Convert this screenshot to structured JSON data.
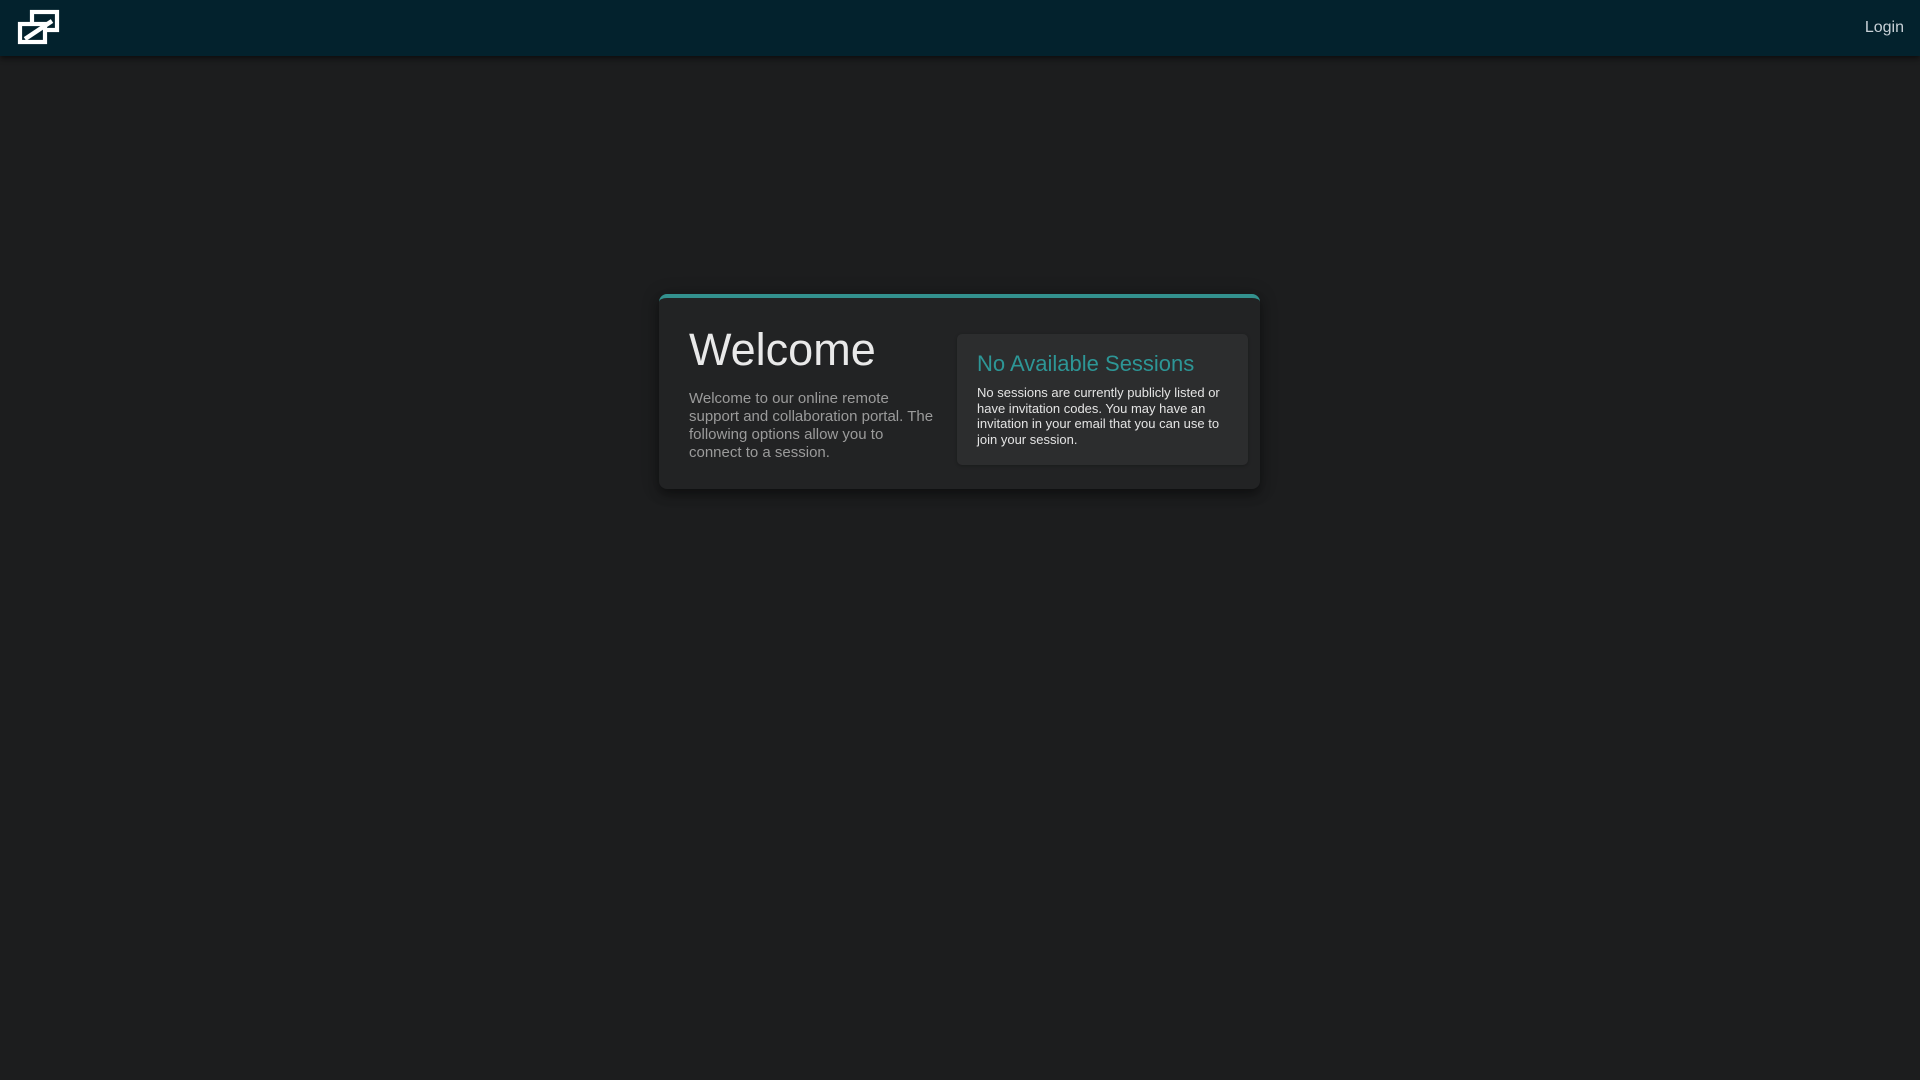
{
  "header": {
    "logo_icon": "overlapping-screens-logo",
    "login_label": "Login"
  },
  "welcome_card": {
    "title": "Welcome",
    "description": "Welcome to our online remote support and collaboration portal. The following options allow you to connect to a session."
  },
  "sessions_panel": {
    "title": "No Available Sessions",
    "message": "No sessions are currently publicly listed or have invitation codes. You may have an invitation in your email that you can use to join your session."
  },
  "colors": {
    "page_bg": "#1c1d1e",
    "header_bg": "#03222d",
    "card_bg": "#222324",
    "panel_bg": "#2c2d2e",
    "accent": "#33918e",
    "panel_title": "#2d9696"
  }
}
